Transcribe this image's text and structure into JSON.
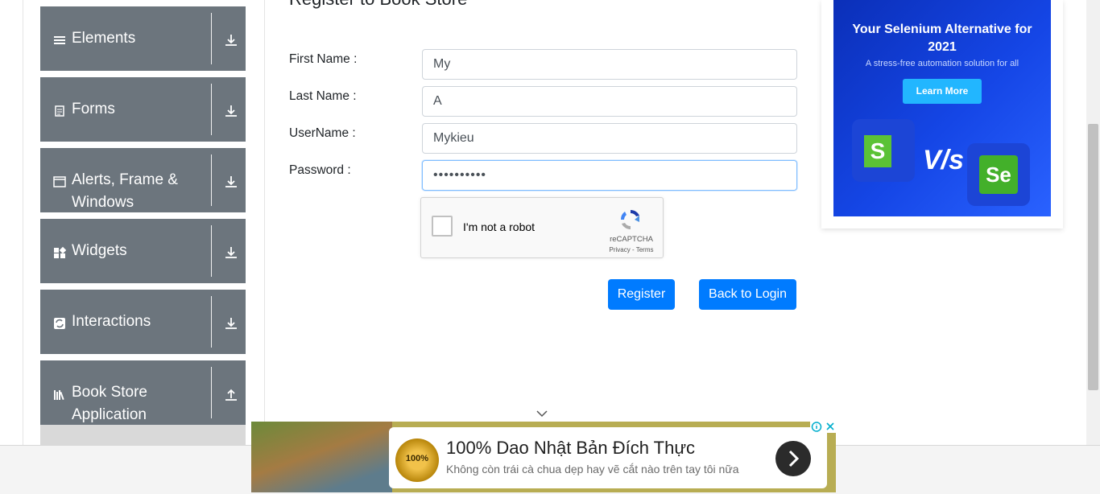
{
  "sidebar": {
    "groups": [
      {
        "label": "Elements",
        "icon": "list-icon",
        "expanded": false
      },
      {
        "label": "Forms",
        "icon": "document-icon",
        "expanded": false
      },
      {
        "label": "Alerts, Frame &\nWindows",
        "icon": "window-icon",
        "expanded": false
      },
      {
        "label": "Widgets",
        "icon": "widgets-icon",
        "expanded": false
      },
      {
        "label": "Interactions",
        "icon": "interactions-icon",
        "expanded": false
      },
      {
        "label": "Book Store\nApplication",
        "icon": "books-icon",
        "expanded": true
      }
    ]
  },
  "form": {
    "title": "Register to Book Store",
    "fields": [
      {
        "label": "First Name :",
        "value": "My"
      },
      {
        "label": "Last Name :",
        "value": "A"
      },
      {
        "label": "UserName :",
        "value": "Mykieu"
      },
      {
        "label": "Password :",
        "value": "••••••••••"
      }
    ],
    "captcha": {
      "text": "I'm not a robot",
      "brand": "reCAPTCHA",
      "terms": "Privacy - Terms"
    },
    "buttons": {
      "register": "Register",
      "back": "Back to Login"
    }
  },
  "side_ad": {
    "headline": "Your Selenium Alternative for 2021",
    "subtext": "A stress-free automation solution for all",
    "cta": "Learn More",
    "vs": "V/s",
    "left_logo": "S",
    "right_logo": "Se"
  },
  "bottom_ad": {
    "badge": "100%",
    "headline": "100% Dao Nhật Bản Đích Thực",
    "subtext": "Không còn trái cà chua dẹp hay vẽ cắt nào trên tay tôi nữa"
  },
  "colors": {
    "primary": "#007bff",
    "sidebar": "#6c757d",
    "ad_blue": "#1546e6",
    "ad_olive": "#b8ad53"
  }
}
